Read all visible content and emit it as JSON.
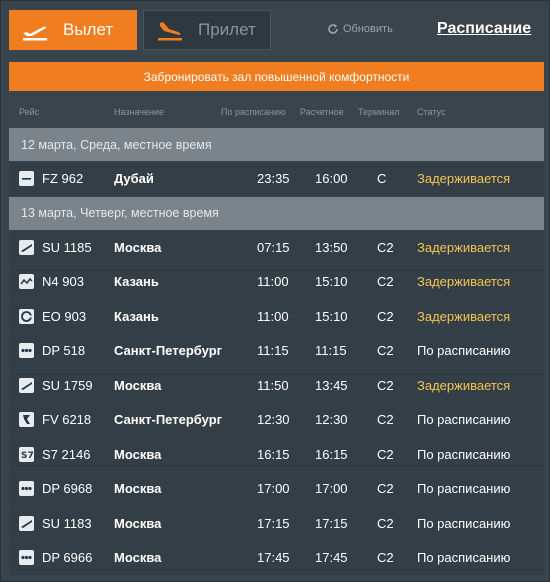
{
  "tabs": {
    "departures": "Вылет",
    "arrivals": "Прилет",
    "refresh": "Обновить",
    "schedule": "Расписание"
  },
  "promo": "Забронировать зал повышенной комфортности",
  "columns": {
    "flight": "Рейс",
    "destination": "Назначение",
    "scheduled": "По расписанию",
    "estimated": "Расчетное",
    "terminal": "Терминал",
    "status": "Статус"
  },
  "colors": {
    "accent": "#f07d1f",
    "delayed": "#f2c552"
  },
  "groups": [
    {
      "date": "12 марта, Среда, местное время",
      "flights": [
        {
          "logo": "flydubai-logo",
          "flight": "FZ 962",
          "destination": "Дубай",
          "scheduled": "23:35",
          "estimated": "16:00",
          "terminal": "C",
          "status": "Задерживается",
          "delayed": true
        }
      ]
    },
    {
      "date": "13 марта, Четверг, местное время",
      "flights": [
        {
          "logo": "aeroflot-logo",
          "flight": "SU 1185",
          "destination": "Москва",
          "scheduled": "07:15",
          "estimated": "13:50",
          "terminal": "C2",
          "status": "Задерживается",
          "delayed": true
        },
        {
          "logo": "nordwind-logo",
          "flight": "N4 903",
          "destination": "Казань",
          "scheduled": "11:00",
          "estimated": "15:10",
          "terminal": "C2",
          "status": "Задерживается",
          "delayed": true
        },
        {
          "logo": "pobeda-logo",
          "flight": "EO 903",
          "destination": "Казань",
          "scheduled": "11:00",
          "estimated": "15:10",
          "terminal": "C2",
          "status": "Задерживается",
          "delayed": true
        },
        {
          "logo": "pobeda-dp-logo",
          "flight": "DP 518",
          "destination": "Санкт-Петербург",
          "scheduled": "11:15",
          "estimated": "11:15",
          "terminal": "C2",
          "status": "По расписанию",
          "delayed": false
        },
        {
          "logo": "aeroflot-logo",
          "flight": "SU 1759",
          "destination": "Москва",
          "scheduled": "11:50",
          "estimated": "13:45",
          "terminal": "C2",
          "status": "Задерживается",
          "delayed": true
        },
        {
          "logo": "rossiya-logo",
          "flight": "FV 6218",
          "destination": "Санкт-Петербург",
          "scheduled": "12:30",
          "estimated": "12:30",
          "terminal": "C2",
          "status": "По расписанию",
          "delayed": false
        },
        {
          "logo": "s7-logo",
          "flight": "S7 2146",
          "destination": "Москва",
          "scheduled": "16:15",
          "estimated": "16:15",
          "terminal": "C2",
          "status": "По расписанию",
          "delayed": false
        },
        {
          "logo": "pobeda-dp-logo",
          "flight": "DP 6968",
          "destination": "Москва",
          "scheduled": "17:00",
          "estimated": "17:00",
          "terminal": "C2",
          "status": "По расписанию",
          "delayed": false
        },
        {
          "logo": "aeroflot-logo",
          "flight": "SU 1183",
          "destination": "Москва",
          "scheduled": "17:15",
          "estimated": "17:15",
          "terminal": "C2",
          "status": "По расписанию",
          "delayed": false
        },
        {
          "logo": "pobeda-dp-logo",
          "flight": "DP 6966",
          "destination": "Москва",
          "scheduled": "17:45",
          "estimated": "17:45",
          "terminal": "C2",
          "status": "По расписанию",
          "delayed": false
        }
      ]
    }
  ]
}
